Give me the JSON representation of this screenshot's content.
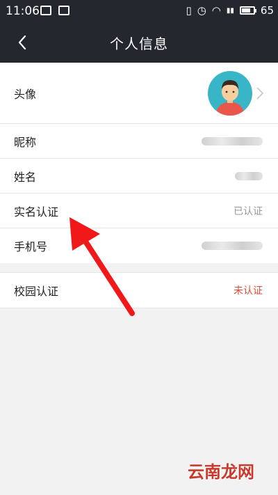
{
  "status_bar": {
    "time": "11:06",
    "battery": "65",
    "icons": [
      "image-icon",
      "notification-icon",
      "vibrate-icon",
      "alarm-icon",
      "wifi-icon",
      "signal-icon",
      "battery-icon"
    ]
  },
  "nav": {
    "title": "个人信息",
    "back_icon": "chevron-left-icon"
  },
  "profile": {
    "rows": [
      {
        "label": "头像",
        "value": "",
        "type": "avatar"
      },
      {
        "label": "昵称",
        "value": "",
        "type": "blurred"
      },
      {
        "label": "姓名",
        "value": "",
        "type": "blurred"
      },
      {
        "label": "实名认证",
        "value": "已认证",
        "type": "text"
      },
      {
        "label": "手机号",
        "value": "",
        "type": "blurred"
      }
    ]
  },
  "campus": {
    "label": "校园认证",
    "value": "未认证"
  },
  "colors": {
    "header_bg": "#24272e",
    "accent_red": "#e34a3a",
    "avatar_bg": "#38b6c7"
  },
  "watermark": "云南龙网"
}
